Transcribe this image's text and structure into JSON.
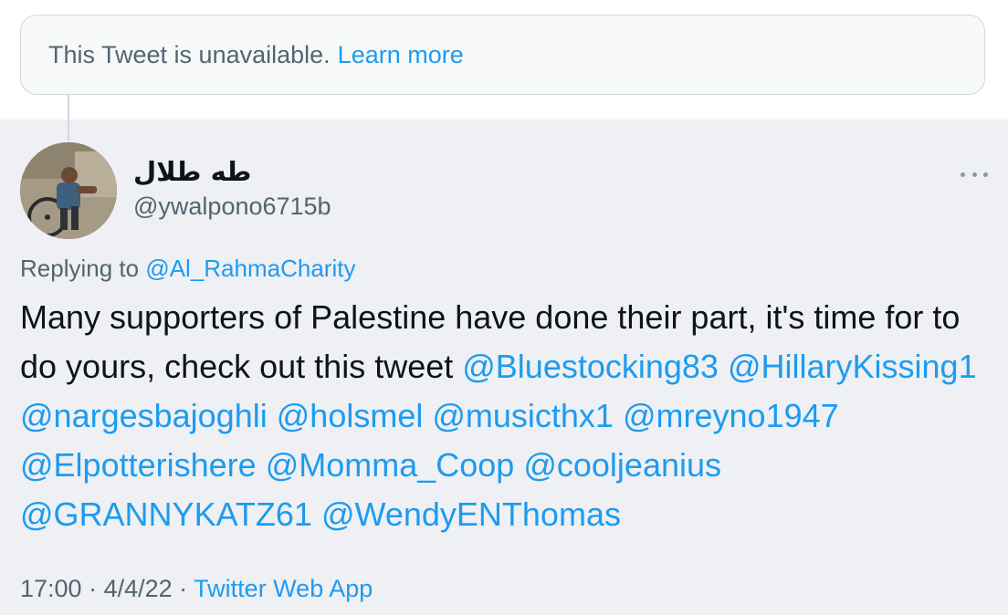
{
  "unavailable": {
    "text": "This Tweet is unavailable.",
    "link": "Learn more"
  },
  "tweet": {
    "author_name": "طه طلال",
    "author_handle": "@ywalpono6715b",
    "replying_prefix": "Replying to ",
    "replying_to": "@Al_RahmaCharity",
    "text_intro": "Many supporters of Palestine have done their part, it's time for to do yours, check out this tweet ",
    "mentions": [
      "@Bluestocking83",
      "@HillaryKissing1",
      "@nargesbajoghli",
      "@holsmel",
      "@musicthx1",
      "@mreyno1947",
      "@Elpotterishere",
      "@Momma_Coop",
      "@cooljeanius",
      "@GRANNYKATZ61",
      "@WendyENThomas"
    ],
    "time": "17:00",
    "date": "4/4/22",
    "separator": " · ",
    "source": "Twitter Web App"
  },
  "icons": {
    "more": "more-horizontal-icon",
    "avatar": "avatar-photo"
  },
  "colors": {
    "link": "#1d9bf0",
    "secondary_text": "#536471",
    "tweet_background": "#eef0f3"
  }
}
